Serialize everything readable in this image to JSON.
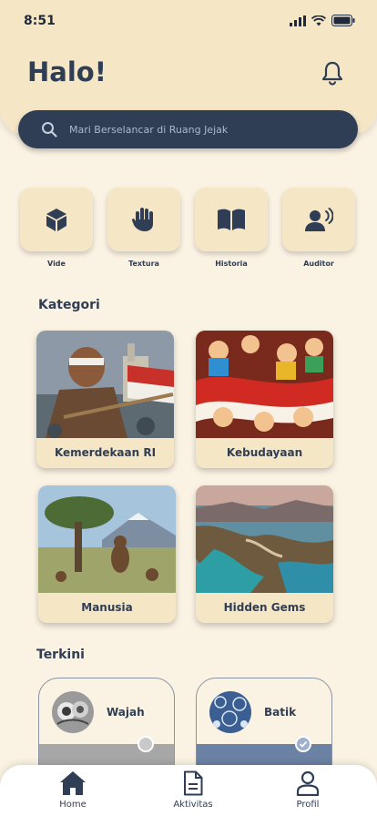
{
  "status": {
    "time": "8:51"
  },
  "header": {
    "title": "Halo!"
  },
  "search": {
    "placeholder": "Mari Berselancar di Ruang Jejak"
  },
  "modes": [
    {
      "label": "Vide",
      "icon": "cube-icon"
    },
    {
      "label": "Textura",
      "icon": "hand-icon"
    },
    {
      "label": "Historia",
      "icon": "book-icon"
    },
    {
      "label": "Auditor",
      "icon": "voice-user-icon"
    }
  ],
  "kategori": {
    "title": "Kategori",
    "items": [
      {
        "label": "Kemerdekaan RI"
      },
      {
        "label": "Kebudayaan"
      },
      {
        "label": "Manusia"
      },
      {
        "label": "Hidden Gems"
      }
    ]
  },
  "terkini": {
    "title": "Terkini",
    "items": [
      {
        "label": "Wajah",
        "completed": false
      },
      {
        "label": "Batik",
        "completed": true
      }
    ]
  },
  "nav": [
    {
      "label": "Home",
      "icon": "home-icon"
    },
    {
      "label": "Aktivitas",
      "icon": "document-icon"
    },
    {
      "label": "Profil",
      "icon": "user-icon"
    }
  ],
  "colors": {
    "primary": "#2f3d55",
    "background": "#faf2e2",
    "accent": "#f5e6c6"
  }
}
